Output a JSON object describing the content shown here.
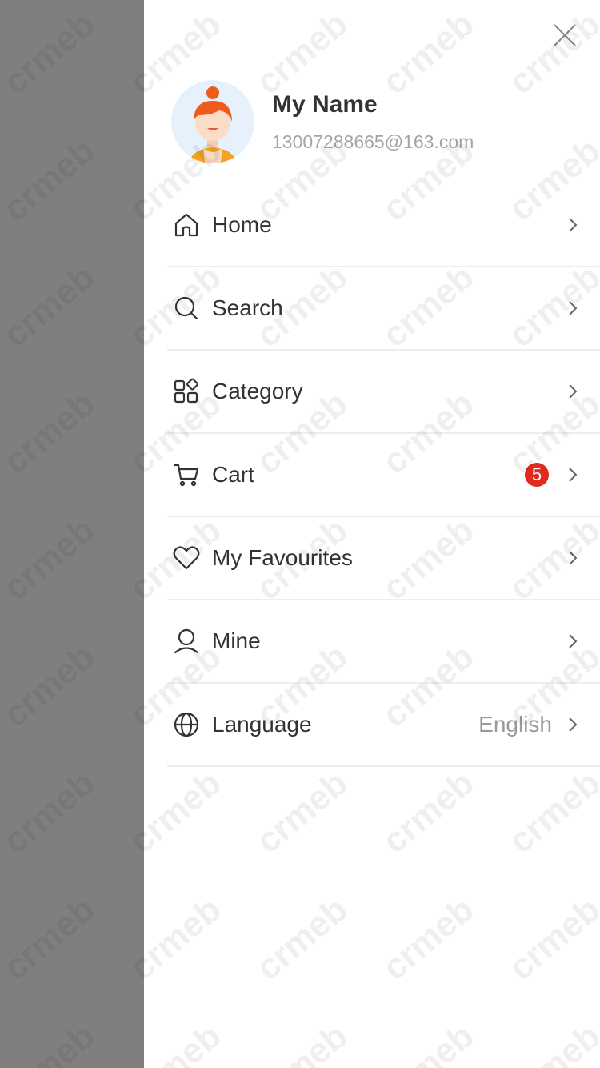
{
  "profile": {
    "name": "My Name",
    "email": "13007288665@163.com"
  },
  "menu": {
    "items": [
      {
        "label": "Home",
        "icon": "home-icon"
      },
      {
        "label": "Search",
        "icon": "search-icon"
      },
      {
        "label": "Category",
        "icon": "category-icon"
      },
      {
        "label": "Cart",
        "icon": "cart-icon",
        "badge": "5"
      },
      {
        "label": "My Favourites",
        "icon": "heart-icon"
      },
      {
        "label": "Mine",
        "icon": "user-icon"
      },
      {
        "label": "Language",
        "icon": "globe-icon",
        "value": "English"
      }
    ]
  },
  "colors": {
    "overlay": "#7f7f7f",
    "badge": "#e0291f",
    "avatar_bg": "#e6f1fb",
    "avatar_hair": "#f05a1a"
  },
  "watermark": "crmeb"
}
